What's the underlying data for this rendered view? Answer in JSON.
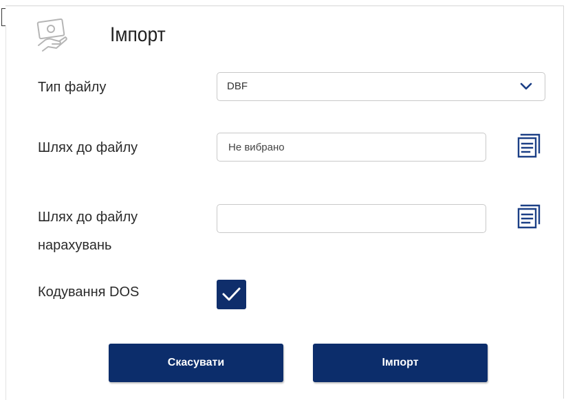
{
  "dialog": {
    "title": "Імпорт",
    "header_icon": "hand-money-icon"
  },
  "form": {
    "file_type": {
      "label": "Тип файлу",
      "selected": "DBF"
    },
    "file_path": {
      "label": "Шлях до файлу",
      "value": "",
      "placeholder": "Не вибрано",
      "browse_icon": "document-list-icon"
    },
    "accruals_path": {
      "label_line1": "Шлях до файлу",
      "label_line2": "нарахувань",
      "value": "",
      "placeholder": "",
      "browse_icon": "document-list-icon"
    },
    "dos_encoding": {
      "label": "Кодування DOS",
      "checked": true
    }
  },
  "buttons": {
    "cancel_label": "Скасувати",
    "import_label": "Імпорт"
  },
  "colors": {
    "primary": "#0c2d6b",
    "icon_blue": "#1b3f86",
    "border": "#c8c8c8"
  }
}
